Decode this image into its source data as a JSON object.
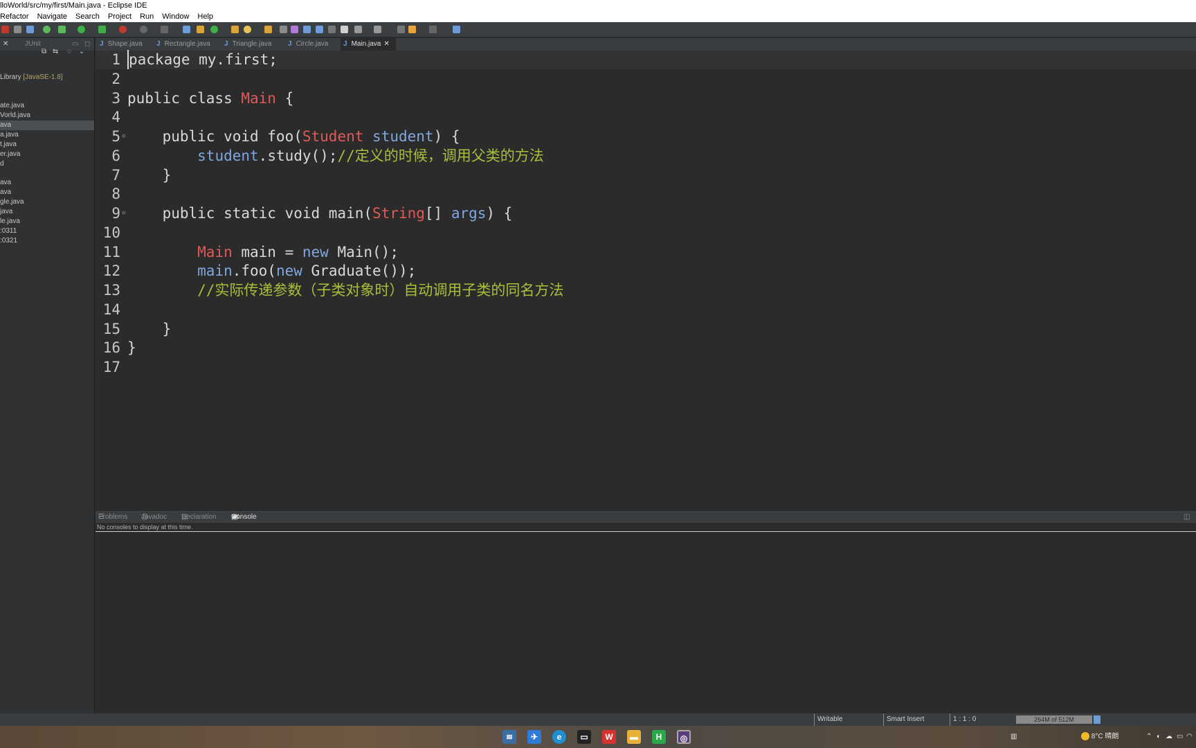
{
  "window": {
    "title": "lloWorld/src/my/first/Main.java - Eclipse IDE"
  },
  "menu": [
    "Refactor",
    "Navigate",
    "Search",
    "Project",
    "Run",
    "Window",
    "Help"
  ],
  "left_pane": {
    "tab_label": "JUnit",
    "items": [
      {
        "label": "Library ",
        "tag": "[JavaSE-1.8]"
      },
      {
        "label": "ate.java"
      },
      {
        "label": "Vorld.java"
      },
      {
        "label": "ava",
        "selected": true
      },
      {
        "label": "a.java"
      },
      {
        "label": "t.java"
      },
      {
        "label": "er.java"
      },
      {
        "label": "d"
      },
      {
        "label": "ava"
      },
      {
        "label": "ava"
      },
      {
        "label": "gle.java"
      },
      {
        "label": "java"
      },
      {
        "label": "le.java"
      },
      {
        "label": ":0311"
      },
      {
        "label": ":0321"
      }
    ]
  },
  "editor_tabs": [
    {
      "label": "Shape.java",
      "active": false
    },
    {
      "label": "Rectangle.java",
      "active": false
    },
    {
      "label": "Triangle.java",
      "active": false
    },
    {
      "label": "Circle.java",
      "active": false
    },
    {
      "label": "Main.java",
      "active": true
    }
  ],
  "code": [
    {
      "n": "1",
      "segs": [
        [
          "k",
          "package my.first;"
        ]
      ]
    },
    {
      "n": "2",
      "segs": []
    },
    {
      "n": "3",
      "segs": [
        [
          "k",
          "public class "
        ],
        [
          "type",
          "Main"
        ],
        [
          "k",
          " {"
        ]
      ]
    },
    {
      "n": "4",
      "segs": []
    },
    {
      "n": "5",
      "fold": true,
      "segs": [
        [
          "k",
          "    public void foo("
        ],
        [
          "type",
          "Student"
        ],
        [
          "k",
          " "
        ],
        [
          "param",
          "student"
        ],
        [
          "k",
          ") {"
        ]
      ]
    },
    {
      "n": "6",
      "segs": [
        [
          "k",
          "        "
        ],
        [
          "param",
          "student"
        ],
        [
          "k",
          ".study();"
        ],
        [
          "comment",
          "//定义的时候，调用父类的方法"
        ]
      ]
    },
    {
      "n": "7",
      "segs": [
        [
          "k",
          "    }"
        ]
      ]
    },
    {
      "n": "8",
      "segs": []
    },
    {
      "n": "9",
      "fold": true,
      "segs": [
        [
          "k",
          "    public static void main("
        ],
        [
          "type",
          "String"
        ],
        [
          "k",
          "[] "
        ],
        [
          "param",
          "args"
        ],
        [
          "k",
          ") {"
        ]
      ]
    },
    {
      "n": "10",
      "segs": []
    },
    {
      "n": "11",
      "segs": [
        [
          "k",
          "        "
        ],
        [
          "type",
          "Main"
        ],
        [
          "k",
          " main = "
        ],
        [
          "kwnew",
          "new"
        ],
        [
          "k",
          " Main();"
        ]
      ]
    },
    {
      "n": "12",
      "segs": [
        [
          "k",
          "        "
        ],
        [
          "param",
          "main"
        ],
        [
          "k",
          ".foo("
        ],
        [
          "kwnew",
          "new"
        ],
        [
          "k",
          " Graduate());"
        ]
      ]
    },
    {
      "n": "13",
      "segs": [
        [
          "comment",
          "        //实际传递参数（子类对象时）自动调用子类的同名方法"
        ]
      ]
    },
    {
      "n": "14",
      "segs": []
    },
    {
      "n": "15",
      "segs": [
        [
          "k",
          "    }"
        ]
      ]
    },
    {
      "n": "16",
      "segs": [
        [
          "k",
          "}"
        ]
      ]
    },
    {
      "n": "17",
      "segs": []
    }
  ],
  "bottom_tabs": [
    {
      "label": "Problems",
      "active": false
    },
    {
      "label": "Javadoc",
      "active": false
    },
    {
      "label": "Declaration",
      "active": false
    },
    {
      "label": "Console",
      "active": true
    }
  ],
  "console_message": "No consoles to display at this time.",
  "status": {
    "writable": "Writable",
    "insert_mode": "Smart Insert",
    "position": "1 : 1 : 0",
    "heap": "264M of 512M"
  },
  "tray": {
    "weather": "8°C  晴朗"
  },
  "colors": {
    "keyword": "#d9d9d9",
    "type": "#e05a57",
    "parameter": "#7fa7e0",
    "comment": "#a6c03a",
    "editor_bg": "#2b2b2b"
  }
}
